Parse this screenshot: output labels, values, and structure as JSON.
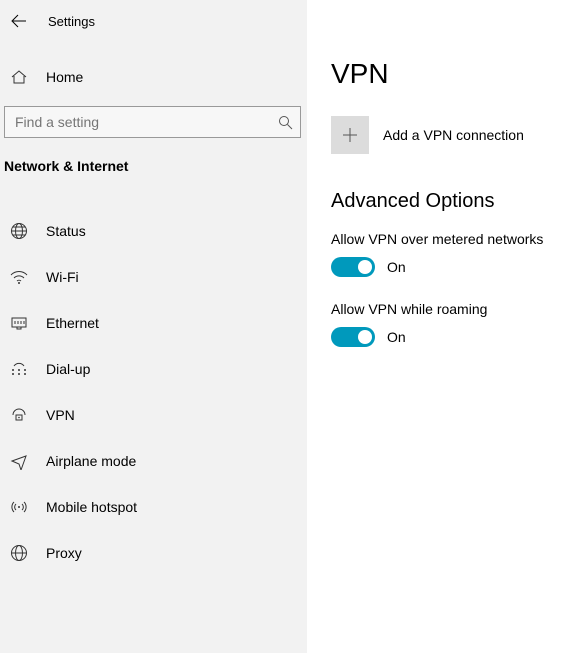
{
  "header": {
    "title": "Settings"
  },
  "sidebar": {
    "home_label": "Home",
    "search_placeholder": "Find a setting",
    "section_label": "Network & Internet",
    "items": [
      {
        "label": "Status"
      },
      {
        "label": "Wi-Fi"
      },
      {
        "label": "Ethernet"
      },
      {
        "label": "Dial-up"
      },
      {
        "label": "VPN"
      },
      {
        "label": "Airplane mode"
      },
      {
        "label": "Mobile hotspot"
      },
      {
        "label": "Proxy"
      }
    ]
  },
  "main": {
    "page_title": "VPN",
    "add_label": "Add a VPN connection",
    "advanced_heading": "Advanced Options",
    "settings": [
      {
        "label": "Allow VPN over metered networks",
        "state": "On"
      },
      {
        "label": "Allow VPN while roaming",
        "state": "On"
      }
    ]
  }
}
